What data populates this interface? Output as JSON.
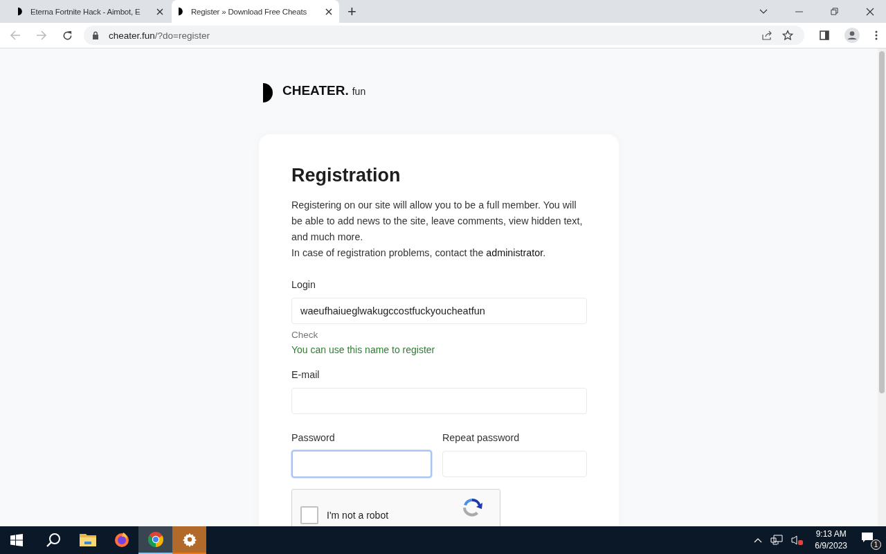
{
  "browser": {
    "tabs": [
      {
        "title": "Eterna Fortnite Hack - Aimbot, E",
        "selected": false
      },
      {
        "title": "Register » Download Free Cheats",
        "selected": true
      }
    ],
    "new_tab": "+",
    "address": {
      "host": "cheater.fun",
      "path": "/?do=register"
    }
  },
  "site": {
    "logo": {
      "name": "CHEATER.",
      "suffix": "fun"
    }
  },
  "form": {
    "title": "Registration",
    "intro": "Registering on our site will allow you to be a full member. You will be able to add news to the site, leave comments, view hidden text, and much more.",
    "contact": {
      "before": "In case of registration problems, contact the ",
      "link": "administrator",
      "after": "."
    },
    "login": {
      "label": "Login",
      "value": "waeufhaiueglwakugccostfuckyoucheatfun",
      "check": "Check",
      "message": "You can use this name to register"
    },
    "email": {
      "label": "E-mail",
      "focused": false
    },
    "password": {
      "label": "Password",
      "focused": true
    },
    "repeat_password": {
      "label": "Repeat password",
      "focused": false
    },
    "captcha": {
      "label": "I'm not a robot",
      "checked": false
    }
  },
  "taskbar": {
    "apps": [
      {
        "kind": "explorer",
        "selected": false
      },
      {
        "kind": "firefox",
        "selected": false
      },
      {
        "kind": "chrome",
        "selected": true
      },
      {
        "kind": "settings",
        "selected": false
      }
    ],
    "time": "9:13 AM",
    "date": "6/9/2023",
    "notifications": "1"
  }
}
